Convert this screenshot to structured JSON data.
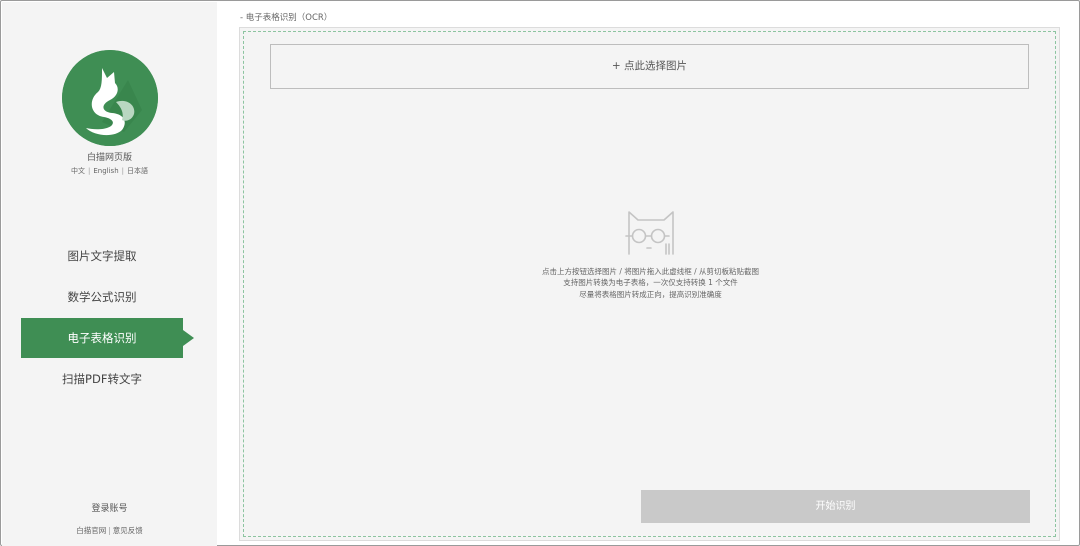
{
  "sidebar": {
    "app_name": "白描网页版",
    "languages": [
      "中文",
      "English",
      "日本語"
    ],
    "nav_items": [
      {
        "label": "图片文字提取",
        "active": false
      },
      {
        "label": "数学公式识别",
        "active": false
      },
      {
        "label": "电子表格识别",
        "active": true
      },
      {
        "label": "扫描PDF转文字",
        "active": false
      }
    ],
    "login_label": "登录账号",
    "footer_links": [
      "白描官网",
      "意见反馈"
    ]
  },
  "main": {
    "title": "- 电子表格识别（OCR）",
    "select_button": "+ 点此选择图片",
    "hints": [
      "点击上方按钮选择图片 / 将图片拖入此虚线框 / 从剪切板粘贴截图",
      "支持图片转换为电子表格，一次仅支持转换 1 个文件",
      "尽量将表格图片转成正向，提高识别准确度"
    ],
    "start_button": "开始识别"
  },
  "colors": {
    "accent": "#3f8e54",
    "sidebar_bg": "#f4f4f4",
    "dropzone_bg": "#f4f4f4",
    "dash_border": "#8cc4a0",
    "disabled_button": "#c9c9c9"
  },
  "icons": {
    "logo": "cat-s-logo-icon",
    "empty_state": "cat-glasses-icon"
  }
}
